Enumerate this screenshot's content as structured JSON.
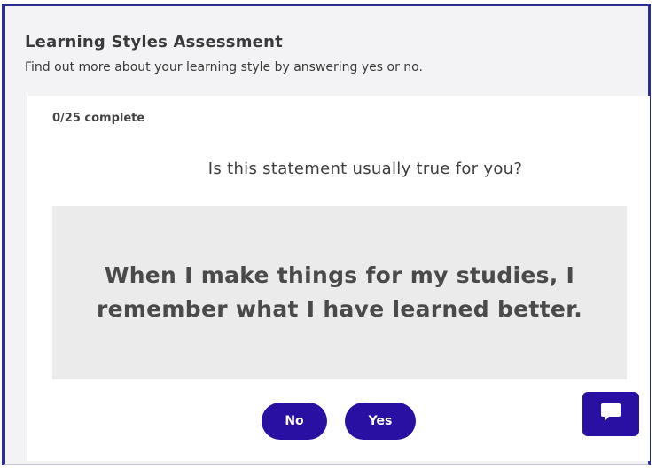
{
  "header": {
    "title": "Learning Styles Assessment",
    "subtitle": "Find out more about your learning style by answering yes or no."
  },
  "card": {
    "progress": "0/25 complete",
    "question": "Is this statement usually true for you?",
    "statement": "When I make things for my studies, I remember what I have learned better.",
    "buttons": {
      "no_label": "No",
      "yes_label": "Yes"
    }
  },
  "chat": {
    "icon": "chat-bubble-icon"
  },
  "colors": {
    "accent": "#2a0fa3",
    "frame_border": "#2a2f8f",
    "statement_bg": "#ebebeb",
    "page_bg": "#f3f3f5"
  }
}
